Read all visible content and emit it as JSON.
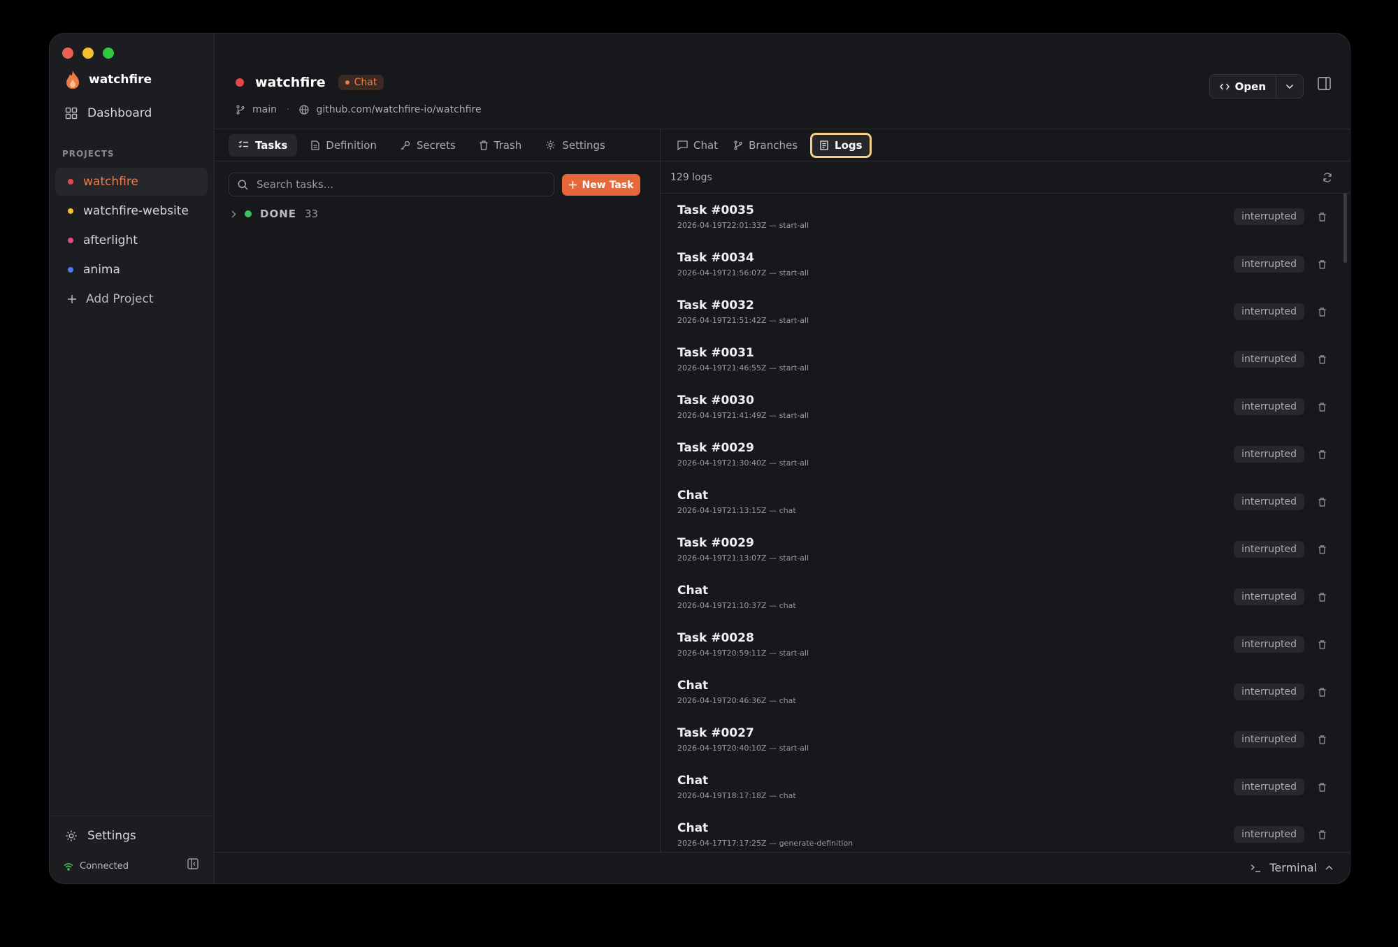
{
  "window": {
    "traffic_colors": [
      "#ec5f57",
      "#f5bf2f",
      "#2fc840"
    ]
  },
  "sidebar": {
    "app_name": "watchfire",
    "dashboard_label": "Dashboard",
    "projects_heading": "PROJECTS",
    "projects": [
      {
        "label": "watchfire",
        "color": "#e5484d",
        "active": true
      },
      {
        "label": "watchfire-website",
        "color": "#f5bf2f",
        "active": false
      },
      {
        "label": "afterlight",
        "color": "#e5487a",
        "active": false
      },
      {
        "label": "anima",
        "color": "#4a7cf0",
        "active": false
      }
    ],
    "add_project_label": "Add Project",
    "settings_label": "Settings",
    "connection_status": "Connected"
  },
  "header": {
    "project_title": "watchfire",
    "mode_badge": "Chat",
    "branch": "main",
    "repo": "github.com/watchfire-io/watchfire",
    "open_label": "Open"
  },
  "left_tabs": [
    "Tasks",
    "Definition",
    "Secrets",
    "Trash",
    "Settings"
  ],
  "tasks": {
    "search_placeholder": "Search tasks...",
    "new_task_label": "New Task",
    "group_label": "DONE",
    "group_count": "33"
  },
  "right_tabs": [
    "Chat",
    "Branches",
    "Logs"
  ],
  "logs": {
    "count_label": "129 logs",
    "rows": [
      {
        "name": "Task #0035",
        "meta": "2026-04-19T22:01:33Z — start-all",
        "status": "interrupted"
      },
      {
        "name": "Task #0034",
        "meta": "2026-04-19T21:56:07Z — start-all",
        "status": "interrupted"
      },
      {
        "name": "Task #0032",
        "meta": "2026-04-19T21:51:42Z — start-all",
        "status": "interrupted"
      },
      {
        "name": "Task #0031",
        "meta": "2026-04-19T21:46:55Z — start-all",
        "status": "interrupted"
      },
      {
        "name": "Task #0030",
        "meta": "2026-04-19T21:41:49Z — start-all",
        "status": "interrupted"
      },
      {
        "name": "Task #0029",
        "meta": "2026-04-19T21:30:40Z — start-all",
        "status": "interrupted"
      },
      {
        "name": "Chat",
        "meta": "2026-04-19T21:13:15Z — chat",
        "status": "interrupted"
      },
      {
        "name": "Task #0029",
        "meta": "2026-04-19T21:13:07Z — start-all",
        "status": "interrupted"
      },
      {
        "name": "Chat",
        "meta": "2026-04-19T21:10:37Z — chat",
        "status": "interrupted"
      },
      {
        "name": "Task #0028",
        "meta": "2026-04-19T20:59:11Z — start-all",
        "status": "interrupted"
      },
      {
        "name": "Chat",
        "meta": "2026-04-19T20:46:36Z — chat",
        "status": "interrupted"
      },
      {
        "name": "Task #0027",
        "meta": "2026-04-19T20:40:10Z — start-all",
        "status": "interrupted"
      },
      {
        "name": "Chat",
        "meta": "2026-04-19T18:17:18Z — chat",
        "status": "interrupted"
      },
      {
        "name": "Chat",
        "meta": "2026-04-17T17:17:25Z — generate-definition",
        "status": "interrupted"
      }
    ]
  },
  "footer": {
    "terminal_label": "Terminal"
  }
}
